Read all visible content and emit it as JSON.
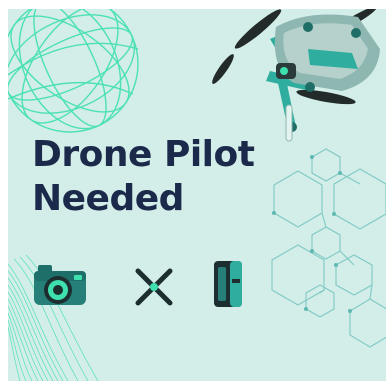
{
  "poster": {
    "headline_line1": "Drone Pilot",
    "headline_line2": "Needed"
  },
  "icons": [
    {
      "name": "camera-icon"
    },
    {
      "name": "propeller-x-icon"
    },
    {
      "name": "battery-icon"
    }
  ],
  "decorations": [
    {
      "name": "wireframe-globe"
    },
    {
      "name": "drone-illustration"
    },
    {
      "name": "hexagon-network"
    },
    {
      "name": "wave-lines"
    }
  ],
  "colors": {
    "background": "#d3ede8",
    "headline": "#1b2a4a",
    "accent_green": "#3ee0ae",
    "drone_teal": "#2f9e95",
    "hex_lines": "#7fc9c4"
  }
}
